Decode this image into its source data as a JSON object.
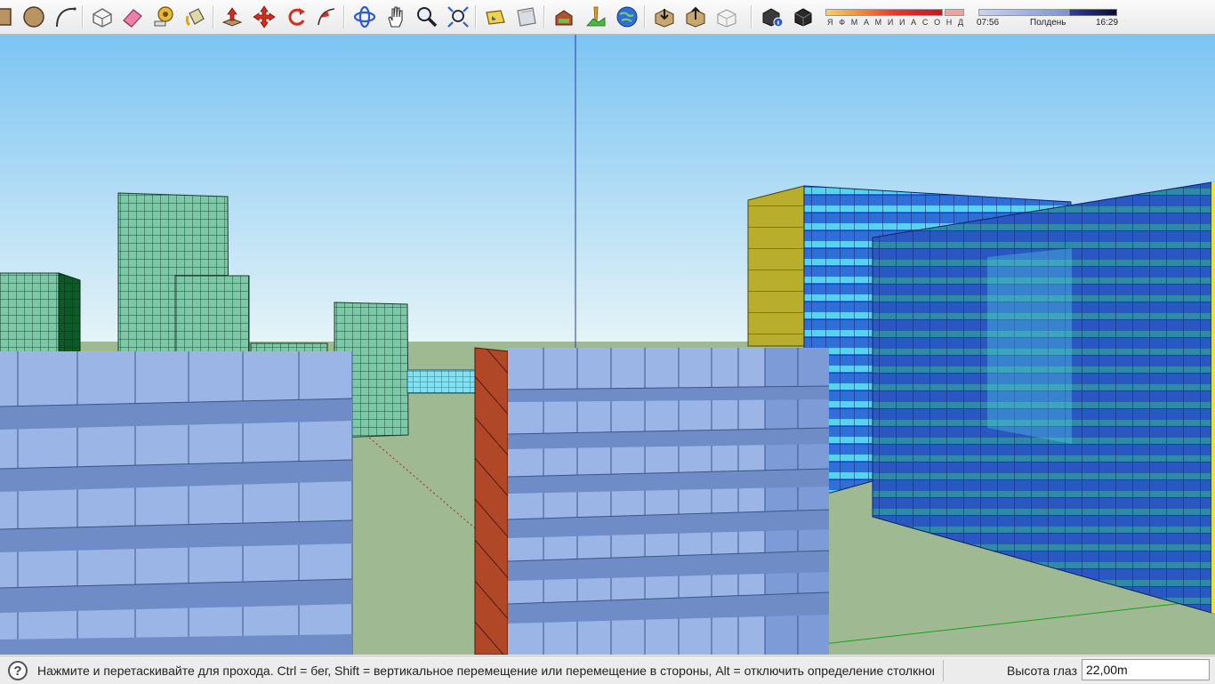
{
  "toolbar": {
    "buttons": [
      {
        "name": "rectangle-tool-button",
        "icon": "rectangle-icon"
      },
      {
        "name": "circle-tool-button",
        "icon": "circle-icon"
      },
      {
        "name": "arc-tool-button",
        "icon": "arc-icon"
      },
      {
        "name": "make-component-button",
        "icon": "component-icon"
      },
      {
        "name": "eraser-tool-button",
        "icon": "eraser-icon"
      },
      {
        "name": "tape-measure-button",
        "icon": "tape-measure-icon"
      },
      {
        "name": "paint-bucket-button",
        "icon": "paint-bucket-icon"
      },
      {
        "name": "push-pull-button",
        "icon": "push-pull-icon"
      },
      {
        "name": "move-tool-button",
        "icon": "move-icon"
      },
      {
        "name": "rotate-tool-button",
        "icon": "rotate-icon"
      },
      {
        "name": "follow-me-button",
        "icon": "follow-me-icon"
      },
      {
        "name": "orbit-tool-button",
        "icon": "orbit-icon"
      },
      {
        "name": "pan-tool-button",
        "icon": "pan-hand-icon"
      },
      {
        "name": "zoom-tool-button",
        "icon": "zoom-icon"
      },
      {
        "name": "zoom-extents-button",
        "icon": "zoom-extents-icon"
      },
      {
        "name": "position-camera-button",
        "icon": "position-camera-icon"
      },
      {
        "name": "walk-tool-button",
        "icon": "walk-icon"
      },
      {
        "name": "look-around-button",
        "icon": "look-around-icon"
      },
      {
        "name": "add-location-button",
        "icon": "add-location-icon"
      },
      {
        "name": "toggle-terrain-button",
        "icon": "terrain-icon"
      },
      {
        "name": "google-earth-button",
        "icon": "earth-icon"
      },
      {
        "name": "get-models-button",
        "icon": "get-models-icon"
      },
      {
        "name": "share-model-button",
        "icon": "share-model-icon"
      },
      {
        "name": "share-component-button",
        "icon": "share-component-icon"
      },
      {
        "name": "shadow-settings-button",
        "icon": "shadow-settings-icon"
      },
      {
        "name": "display-shadows-button",
        "icon": "shadows-icon"
      }
    ],
    "shadows": {
      "months": "Я Ф М А М И И А С О Н Д",
      "time_start": "07:56",
      "time_noon": "Полдень",
      "time_end": "16:29"
    }
  },
  "statusbar": {
    "help_icon": "question-icon",
    "message": "Нажмите и перетаскивайте для прохода.  Ctrl = бег, Shift = вертикальное перемещение или перемещение в стороны, Alt = отключить определение столкновений",
    "eye_height_label": "Высота глаз",
    "eye_height_value": "22,00m"
  },
  "colors": {
    "sky_top": "#7cc4f2",
    "sky_bottom": "#e6f4f7",
    "ground": "#9fba92",
    "building_light_blue": "#9bb6e6",
    "building_deep_blue": "#2a57c2",
    "building_green": "#7dc9a7",
    "building_cyan": "#55d6e6",
    "facade_brick": "#b04828",
    "facade_yellow": "#b9ad2c"
  }
}
